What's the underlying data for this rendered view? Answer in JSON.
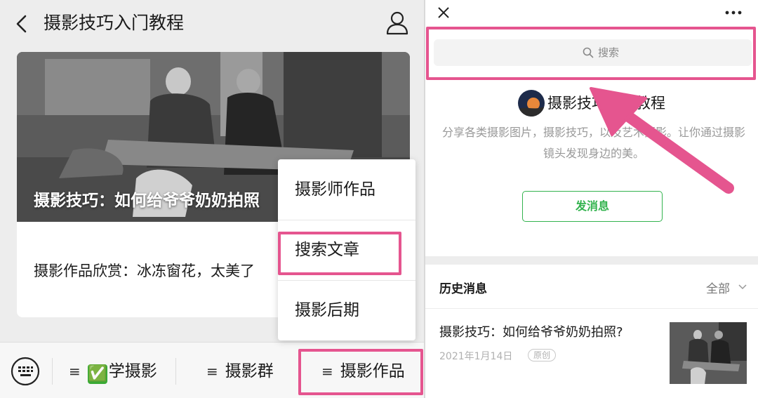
{
  "left": {
    "header": {
      "title": "摄影技巧入门教程",
      "back_icon": "chevron-left-icon",
      "profile_icon": "person-icon"
    },
    "card": {
      "overlay_title": "摄影技巧：如何给爷爷奶奶拍照",
      "subtitle": "摄影作品欣赏：冰冻窗花，太美了"
    },
    "popup_menu": {
      "items": [
        {
          "label": "摄影师作品"
        },
        {
          "label": "搜索文章"
        },
        {
          "label": "摄影后期"
        }
      ]
    },
    "bottom_menu": {
      "keyboard_icon": "keyboard-icon",
      "items": [
        {
          "label": "学摄影",
          "emoji": "✅"
        },
        {
          "label": "摄影群"
        },
        {
          "label": "摄影作品"
        }
      ]
    }
  },
  "right": {
    "close_icon": "close-icon",
    "more_icon": "more-dots-icon",
    "search": {
      "placeholder": "搜索",
      "icon": "search-icon"
    },
    "account": {
      "name": "摄影技巧入门教程",
      "description": "分享各类摄影图片，摄影技巧，以及艺术摄影。让你通过摄影镜头发现身边的美。"
    },
    "send_message_label": "发消息",
    "history": {
      "title": "历史消息",
      "filter": "全部",
      "articles": [
        {
          "title": "摄影技巧：如何给爷爷奶奶拍照?",
          "date": "2021年1月14日",
          "badge": "原创"
        }
      ]
    }
  },
  "colors": {
    "highlight_pink": "#e5558f",
    "wechat_green": "#33b34e"
  }
}
